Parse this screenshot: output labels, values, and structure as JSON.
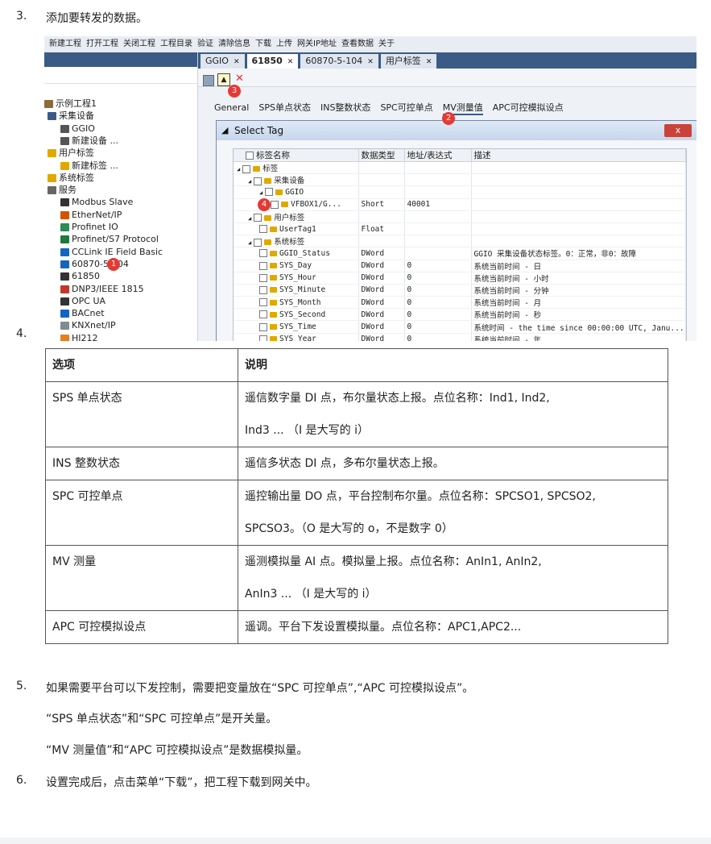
{
  "steps": {
    "s3": {
      "num": "3.",
      "text": "添加要转发的数据。"
    },
    "s4": {
      "num": "4."
    },
    "s5": {
      "num": "5.",
      "text": "如果需要平台可以下发控制，需要把变量放在“SPC 可控单点”,“APC 可控模拟设点”。"
    },
    "s5_note1": "“SPS 单点状态”和“SPC 可控单点”是开关量。",
    "s5_note2": "“MV 测量值”和“APC 可控模拟设点”是数据模拟量。",
    "s6": {
      "num": "6.",
      "text": "设置完成后，点击菜单“下载”，把工程下载到网关中。"
    }
  },
  "screenshot": {
    "toolbar": [
      "新建工程",
      "打开工程",
      "关闭工程",
      "工程目录",
      "验证",
      "清除信息",
      "下载",
      "上传",
      "网关IP地址",
      "查看数据",
      "关于"
    ],
    "tree": [
      {
        "label": "示例工程1",
        "icon": "folder-icon"
      },
      {
        "label": "采集设备",
        "icon": "device-icon"
      },
      {
        "label": "GGIO",
        "icon": "grid-icon"
      },
      {
        "label": "新建设备 ...",
        "icon": "grid-icon"
      },
      {
        "label": "用户标签",
        "icon": "tag-icon"
      },
      {
        "label": "新建标签 ...",
        "icon": "tag-icon"
      },
      {
        "label": "系统标签",
        "icon": "tag-icon"
      },
      {
        "label": "服务",
        "icon": "service-icon"
      },
      {
        "label": "Modbus Slave",
        "icon": "modbus-icon"
      },
      {
        "label": "EtherNet/IP",
        "icon": "ethernet-icon"
      },
      {
        "label": "Profinet IO",
        "icon": "profinet-icon"
      },
      {
        "label": "Profinet/S7 Protocol",
        "icon": "s7-icon"
      },
      {
        "label": "CCLink IE Field Basic",
        "icon": "cclink-icon"
      },
      {
        "label": "60870-5-104",
        "icon": "iec-icon"
      },
      {
        "label": "61850",
        "icon": "iec61850-icon"
      },
      {
        "label": "DNP3/IEEE 1815",
        "icon": "dnp3-icon"
      },
      {
        "label": "OPC UA",
        "icon": "opcua-icon"
      },
      {
        "label": "BACnet",
        "icon": "bacnet-icon"
      },
      {
        "label": "KNXnet/IP",
        "icon": "knx-icon"
      },
      {
        "label": "HJ212",
        "icon": "hj212-icon"
      }
    ],
    "doc_tabs": [
      "GGIO",
      "61850",
      "60870-5-104",
      "用户标签"
    ],
    "page_tabs": [
      "General",
      "SPS单点状态",
      "INS整数状态",
      "SPC可控单点",
      "MV测量值",
      "APC可控模拟设点"
    ],
    "active_page_tab": 4,
    "dialog_title": "Select Tag",
    "dialog_close": "x",
    "grid_headers": [
      "标签名称",
      "数据类型",
      "地址/表达式",
      "描述"
    ],
    "grid_rows": [
      {
        "name": "标签",
        "type": "",
        "addr": "",
        "desc": "",
        "indent": 0
      },
      {
        "name": "采集设备",
        "type": "",
        "addr": "",
        "desc": "",
        "indent": 1
      },
      {
        "name": "GGIO",
        "type": "",
        "addr": "",
        "desc": "",
        "indent": 2
      },
      {
        "name": "VFBOX1/G...",
        "type": "Short",
        "addr": "40001",
        "desc": "",
        "indent": 3
      },
      {
        "name": "用户标签",
        "type": "",
        "addr": "",
        "desc": "",
        "indent": 1
      },
      {
        "name": "UserTag1",
        "type": "Float",
        "addr": "",
        "desc": "",
        "indent": 2
      },
      {
        "name": "系统标签",
        "type": "",
        "addr": "",
        "desc": "",
        "indent": 1
      },
      {
        "name": "GGIO_Status",
        "type": "DWord",
        "addr": "",
        "desc": "GGIO 采集设备状态标签。0：正常，非0：故障",
        "indent": 2
      },
      {
        "name": "SYS_Day",
        "type": "DWord",
        "addr": "0",
        "desc": "系统当前时间 - 日",
        "indent": 2
      },
      {
        "name": "SYS_Hour",
        "type": "DWord",
        "addr": "0",
        "desc": "系统当前时间 - 小时",
        "indent": 2
      },
      {
        "name": "SYS_Minute",
        "type": "DWord",
        "addr": "0",
        "desc": "系统当前时间 - 分钟",
        "indent": 2
      },
      {
        "name": "SYS_Month",
        "type": "DWord",
        "addr": "0",
        "desc": "系统当前时间 - 月",
        "indent": 2
      },
      {
        "name": "SYS_Second",
        "type": "DWord",
        "addr": "0",
        "desc": "系统当前时间 - 秒",
        "indent": 2
      },
      {
        "name": "SYS_Time",
        "type": "DWord",
        "addr": "0",
        "desc": "系统时间 - the time since 00:00:00 UTC, Janu...",
        "indent": 2
      },
      {
        "name": "SYS_Year",
        "type": "DWord",
        "addr": "0",
        "desc": "系统当前时间 - 年",
        "indent": 2
      }
    ],
    "badges": [
      "1",
      "2",
      "3",
      "4"
    ]
  },
  "options_table": {
    "headers": [
      "选项",
      "说明"
    ],
    "rows": [
      {
        "name": "SPS 单点状态",
        "lines": [
          "遥信数字量 DI 点，布尔量状态上报。点位名称：Ind1, Ind2,",
          "Ind3 ... （I 是大写的 i）"
        ]
      },
      {
        "name": "INS 整数状态",
        "lines": [
          "遥信多状态 DI 点，多布尔量状态上报。"
        ]
      },
      {
        "name": "SPC 可控单点",
        "lines": [
          "遥控输出量 DO 点，平台控制布尔量。点位名称：SPCSO1, SPCSO2,",
          "SPCSO3。（O 是大写的 o，不是数字 0）"
        ]
      },
      {
        "name": "MV 测量",
        "lines": [
          "遥测模拟量 AI 点。模拟量上报。点位名称：AnIn1, AnIn2,",
          "AnIn3 ... （I 是大写的 i）"
        ]
      },
      {
        "name": "APC 可控模拟设点",
        "lines": [
          "遥调。平台下发设置模拟量。点位名称：APC1,APC2..."
        ]
      }
    ]
  },
  "colors": {
    "accent": "#3b5b86",
    "badge": "#e53935"
  }
}
